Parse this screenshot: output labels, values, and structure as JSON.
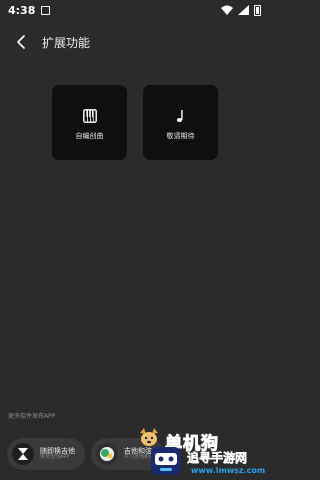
{
  "status_bar": {
    "time": "4:38"
  },
  "header": {
    "title": "扩展功能"
  },
  "features": [
    {
      "label": "自编创曲",
      "icon": "piano-keys-icon"
    },
    {
      "label": "敬请期待",
      "icon": "music-note-icon"
    }
  ],
  "bottom": {
    "source_label": "更多软件发布APP",
    "apps": [
      {
        "name": "随即换吉他",
        "sub": "免费吉他APP",
        "icon": "hourglass-icon"
      },
      {
        "name": "吉他和弦",
        "sub": "学习吉他和弦",
        "icon": "avatar-icon"
      }
    ]
  },
  "watermark": {
    "line1": "单机狗",
    "line2": "追寻手游网",
    "url": "www.lmwsz.com"
  }
}
